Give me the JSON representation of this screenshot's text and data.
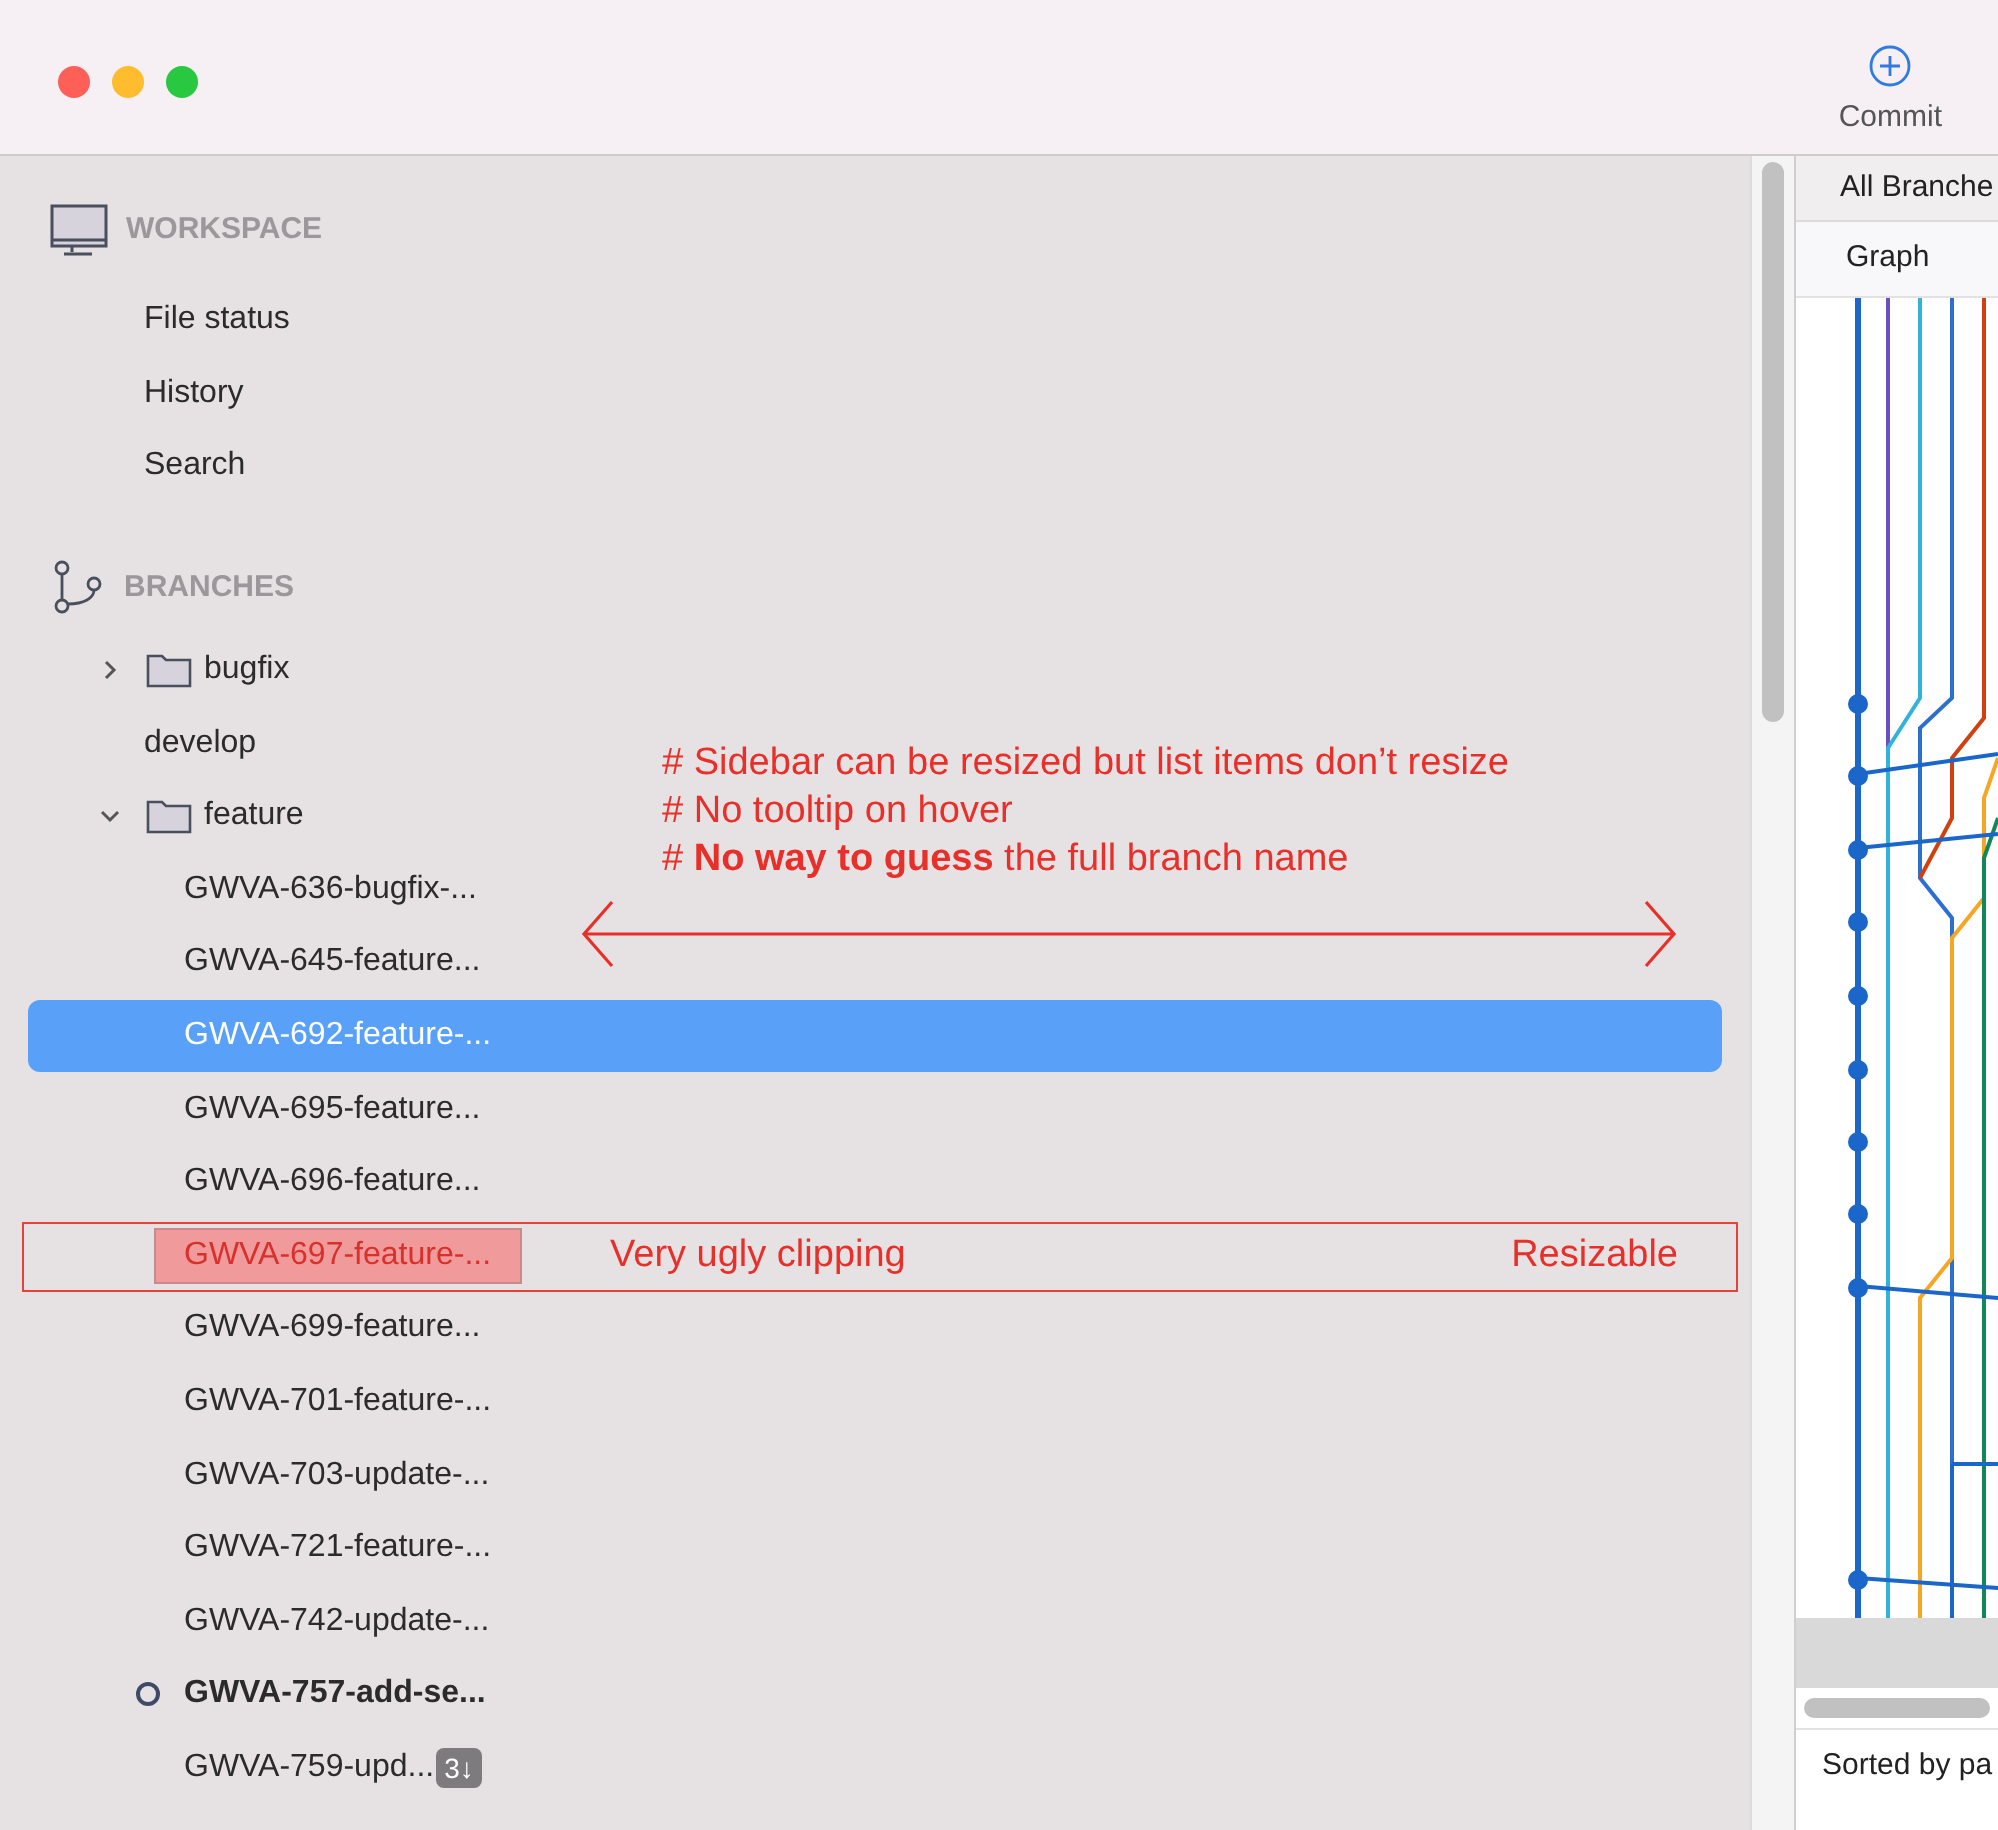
{
  "window": {
    "controls": [
      {
        "kind": "close"
      },
      {
        "kind": "minimize"
      },
      {
        "kind": "zoom"
      }
    ]
  },
  "toolbar": {
    "commit": "Commit"
  },
  "sidebar": {
    "workspace": {
      "title": "WORKSPACE",
      "items": [
        "File status",
        "History",
        "Search"
      ]
    },
    "branches": {
      "title": "BRANCHES",
      "items": [
        {
          "kind": "folder",
          "label": "bugfix",
          "expanded": false
        },
        {
          "kind": "branch",
          "label": "develop",
          "selected": false,
          "current": false,
          "annotated": false
        },
        {
          "kind": "folder",
          "label": "feature",
          "expanded": true,
          "children": [
            {
              "kind": "branch",
              "label": "GWVA-636-bugfix-...",
              "selected": false,
              "current": false,
              "annotated": false
            },
            {
              "kind": "branch",
              "label": "GWVA-645-feature...",
              "selected": false,
              "current": false,
              "annotated": false
            },
            {
              "kind": "branch",
              "label": "GWVA-692-feature-...",
              "selected": true,
              "current": false,
              "annotated": false
            },
            {
              "kind": "branch",
              "label": "GWVA-695-feature...",
              "selected": false,
              "current": false,
              "annotated": false
            },
            {
              "kind": "branch",
              "label": "GWVA-696-feature...",
              "selected": false,
              "current": false,
              "annotated": false
            },
            {
              "kind": "branch",
              "label": "GWVA-697-feature-...",
              "selected": false,
              "current": false,
              "annotated": true
            },
            {
              "kind": "branch",
              "label": "GWVA-699-feature...",
              "selected": false,
              "current": false,
              "annotated": false
            },
            {
              "kind": "branch",
              "label": "GWVA-701-feature-...",
              "selected": false,
              "current": false,
              "annotated": false
            },
            {
              "kind": "branch",
              "label": "GWVA-703-update-...",
              "selected": false,
              "current": false,
              "annotated": false
            },
            {
              "kind": "branch",
              "label": "GWVA-721-feature-...",
              "selected": false,
              "current": false,
              "annotated": false
            },
            {
              "kind": "branch",
              "label": "GWVA-742-update-...",
              "selected": false,
              "current": false,
              "annotated": false
            },
            {
              "kind": "branch",
              "label": "GWVA-757-add-se...",
              "selected": false,
              "current": true,
              "annotated": false
            },
            {
              "kind": "branch",
              "label": "GWVA-759-upd...",
              "badge": "3↓",
              "selected": false,
              "current": false,
              "annotated": false
            }
          ]
        }
      ]
    }
  },
  "annotations": {
    "notes": [
      "# Sidebar can be resized but list items don’t resize",
      "# No tooltip on hover",
      "# **No way to guess** the full branch name"
    ],
    "row_callout": {
      "label": "Very ugly clipping",
      "tag": "Resizable"
    }
  },
  "right_panel": {
    "filter": "All Branche",
    "column": "Graph",
    "sort": "Sorted by pa"
  }
}
